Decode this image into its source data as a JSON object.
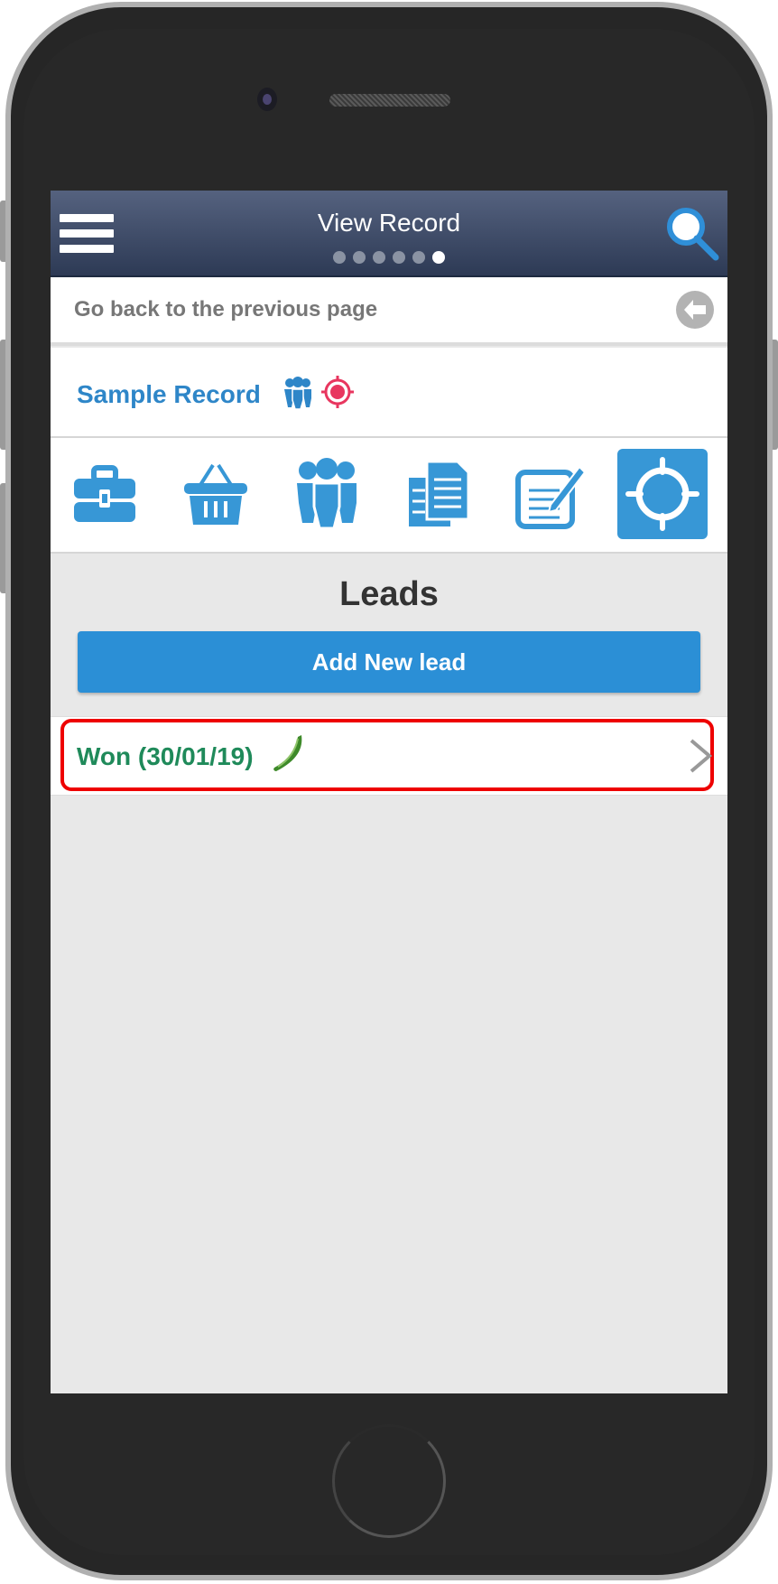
{
  "header": {
    "title": "View Record",
    "page_dots": {
      "count": 6,
      "active_index": 5
    },
    "menu_icon": "hamburger-menu-icon",
    "search_icon": "search-icon"
  },
  "back_bar": {
    "label": "Go back to the previous page",
    "icon": "back-arrow-icon"
  },
  "record": {
    "name": "Sample Record",
    "icons": [
      "group-icon",
      "target-icon"
    ]
  },
  "nav_icons": [
    {
      "name": "briefcase-icon",
      "active": false
    },
    {
      "name": "basket-icon",
      "active": false
    },
    {
      "name": "group-icon",
      "active": false
    },
    {
      "name": "documents-icon",
      "active": false
    },
    {
      "name": "edit-note-icon",
      "active": false
    },
    {
      "name": "target-icon",
      "active": true
    }
  ],
  "leads": {
    "title": "Leads",
    "add_button_label": "Add New lead",
    "items": [
      {
        "label": "Won (30/01/19)",
        "icon": "pepper-icon",
        "highlighted": true
      }
    ]
  },
  "colors": {
    "accent_blue": "#2b8fd6",
    "record_blue": "#2e86c8",
    "won_green": "#1f8a5a",
    "highlight_red": "#ee0000",
    "target_pink": "#e8365f"
  }
}
